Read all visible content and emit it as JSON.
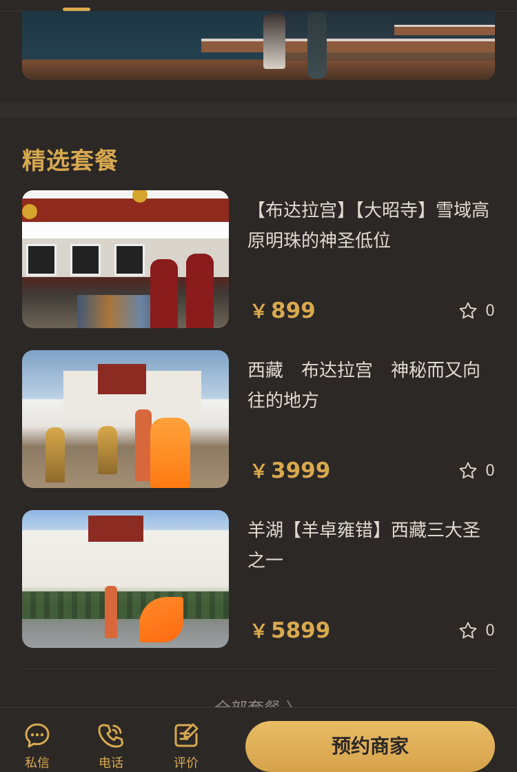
{
  "section_title": "精选套餐",
  "packages": [
    {
      "title": "【布达拉宫】【大昭寺】雪域高原明珠的神圣低位",
      "currency": "￥",
      "price": "899",
      "likes": "0"
    },
    {
      "title": "西藏　布达拉宫　神秘而又向往的地方",
      "currency": "￥",
      "price": "3999",
      "likes": "0"
    },
    {
      "title": "羊湖【羊卓雍错】西藏三大圣之一",
      "currency": "￥",
      "price": "5899",
      "likes": "0"
    }
  ],
  "all_packages_link": "全部套餐 〉",
  "bottom_bar": {
    "message_label": "私信",
    "phone_label": "电话",
    "review_label": "评价",
    "book_button": "预约商家"
  },
  "colors": {
    "accent": "#d9a94f",
    "background": "#2b2826",
    "button": "#e2b25c"
  }
}
